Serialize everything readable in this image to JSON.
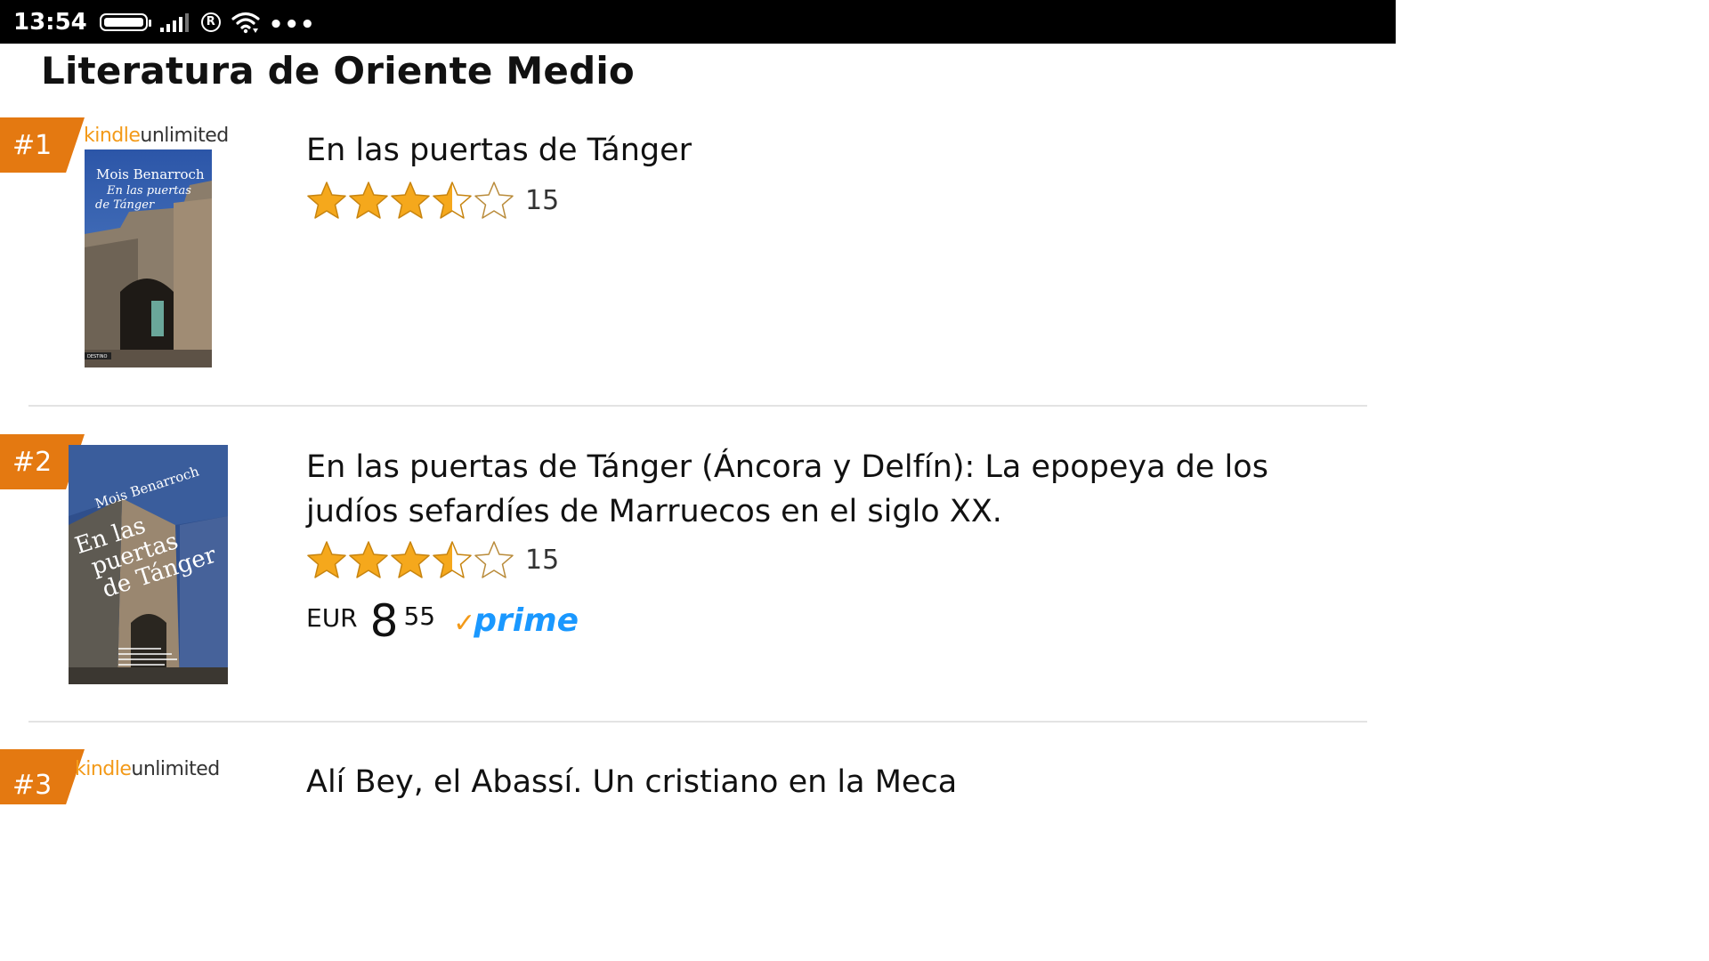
{
  "status_bar": {
    "time": "13:54",
    "registered_mark": "R",
    "more": "•••"
  },
  "page": {
    "title": "Literatura de Oriente Medio"
  },
  "kindle_unlimited": {
    "kindle": "kindle",
    "unlimited": "unlimited"
  },
  "items": [
    {
      "rank": "#1",
      "title": "En las puertas de Tánger",
      "rating_value": 3.5,
      "rating_max": 5,
      "rating_count": "15",
      "kindle_unlimited": true,
      "cover": {
        "author": "Mois Benarroch",
        "title_line1": "En las puertas",
        "title_line2": "de Tánger",
        "publisher": "DESTINO"
      }
    },
    {
      "rank": "#2",
      "title": "En las puertas de Tánger (Áncora y Delfín): La epopeya de los judíos sefardíes de Marruecos en el siglo XX.",
      "rating_value": 3.5,
      "rating_max": 5,
      "rating_count": "15",
      "kindle_unlimited": false,
      "price_currency": "EUR",
      "price_whole": "8",
      "price_fraction": "55",
      "prime_check": "✓",
      "prime_label": "prime",
      "cover": {
        "author": "Mois Benarroch",
        "title_line1": "En las",
        "title_line2": "puertas",
        "title_line3": "de Tánger"
      }
    },
    {
      "rank": "#3",
      "title": "Alí Bey, el Abassí. Un cristiano en la Meca",
      "kindle_unlimited": true
    }
  ],
  "colors": {
    "rank_badge": "#e47911",
    "star_fill": "#f5a81c",
    "prime_blue": "#1a98ff",
    "prime_check": "#f39a19",
    "kindle_orange": "#f39a19",
    "status_bar": "#000000"
  }
}
